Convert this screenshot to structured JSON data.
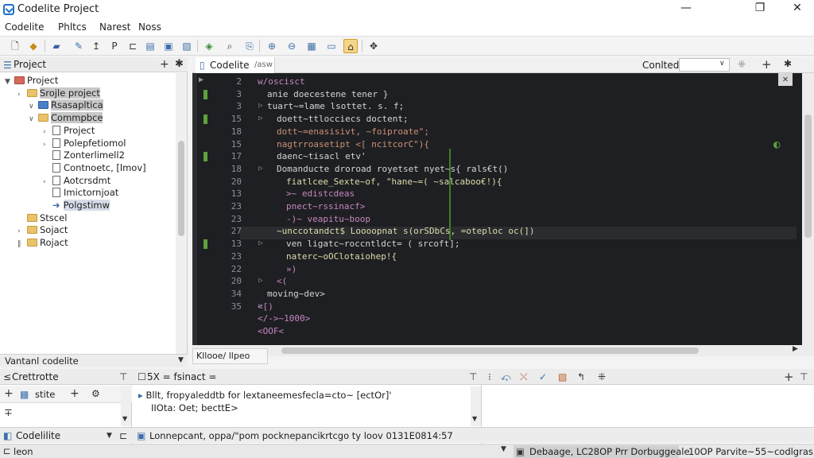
{
  "window": {
    "title": "Codelite Project",
    "minimize": "—",
    "maximize": "❐",
    "close": "✕"
  },
  "menu": [
    "Codelite",
    "Phltcs",
    "Narest",
    "Noss"
  ],
  "project_panel": {
    "title": "Project",
    "tree": [
      {
        "label": "Project",
        "depth": 0,
        "arrow": "▼",
        "kind": "proj",
        "selected": false
      },
      {
        "label": "Srojle project",
        "depth": 1,
        "arrow": "›",
        "kind": "folder",
        "selected": "gray"
      },
      {
        "label": "Rsasapltica",
        "depth": 2,
        "arrow": "∨",
        "kind": "folder-blue",
        "selected": "gray"
      },
      {
        "label": "Commpbce",
        "depth": 2,
        "arrow": "∨",
        "kind": "folder",
        "selected": "gray"
      },
      {
        "label": "Project",
        "depth": 3,
        "arrow": "›",
        "kind": "file",
        "selected": false
      },
      {
        "label": "Polepfetiomol",
        "depth": 3,
        "arrow": "›",
        "kind": "file",
        "selected": false
      },
      {
        "label": "Zonterlimell2",
        "depth": 3,
        "arrow": "",
        "kind": "file",
        "selected": false
      },
      {
        "label": "Contnoetc, [lmov]",
        "depth": 3,
        "arrow": "",
        "kind": "file",
        "selected": false
      },
      {
        "label": "Aotcrsdmt",
        "depth": 3,
        "arrow": "›",
        "kind": "file",
        "selected": false
      },
      {
        "label": "Imictornjoat",
        "depth": 3,
        "arrow": "",
        "kind": "file",
        "selected": false
      },
      {
        "label": "Polgstimw",
        "depth": 3,
        "arrow": "",
        "kind": "arrow-file",
        "selected": "blue"
      },
      {
        "label": "Stscel",
        "depth": 1,
        "arrow": "",
        "kind": "folder",
        "selected": false
      },
      {
        "label": "Sojact",
        "depth": 1,
        "arrow": "›",
        "kind": "folder",
        "selected": false
      },
      {
        "label": "Rojact",
        "depth": 1,
        "arrow": "‖",
        "kind": "folder",
        "selected": false
      }
    ],
    "footer": "Vantanl codelite"
  },
  "editor": {
    "tab_label": "Codelite",
    "tab_sub": "/asw",
    "right_label": "Conlted",
    "bottom_tab": "Kllooe/ llpeo",
    "lines": [
      {
        "num": "2",
        "code": "w/oscisct",
        "indent": 0,
        "color": "#c586c0",
        "marker": false,
        "fold": ""
      },
      {
        "num": "3",
        "code": "anie doecestene tener }",
        "indent": 1,
        "color": "#d4d4d4",
        "marker": true,
        "fold": ""
      },
      {
        "num": "3",
        "code": "tuart~=lame lsottet. s. f;",
        "indent": 1,
        "color": "#d4d4d4",
        "marker": false,
        "fold": "▷"
      },
      {
        "num": "15",
        "code": "doett~ttlocciecs doctent;",
        "indent": 2,
        "color": "#d4d4d4",
        "marker": true,
        "fold": "▷"
      },
      {
        "num": "18",
        "code": "dott~=enasisivt, ~foiproate\";",
        "indent": 2,
        "color": "#ce9178",
        "marker": false,
        "fold": ""
      },
      {
        "num": "15",
        "code": "nagtrroasetipt <[ ncitcorC\"){",
        "indent": 2,
        "color": "#ce9178",
        "marker": false,
        "fold": ""
      },
      {
        "num": "17",
        "code": "daenc~tisacl etv'",
        "indent": 2,
        "color": "#d4d4d4",
        "marker": true,
        "fold": ""
      },
      {
        "num": "18",
        "code": "Domanducte droroad royetset nyet~s{ rals€t()",
        "indent": 2,
        "color": "#d4d4d4",
        "marker": false,
        "fold": "▷"
      },
      {
        "num": "20",
        "code": "fiatlcee_Sexte~of, \"hane~=( ~salcaboo€!){",
        "indent": 3,
        "color": "#dcdcaa",
        "marker": false,
        "fold": ""
      },
      {
        "num": "13",
        "code": ">~ edistcdeas",
        "indent": 3,
        "color": "#c586c0",
        "marker": false,
        "fold": ""
      },
      {
        "num": "23",
        "code": "pnect~rssinacf>",
        "indent": 3,
        "color": "#c586c0",
        "marker": false,
        "fold": ""
      },
      {
        "num": "23",
        "code": "-)~ veapitu~boop",
        "indent": 3,
        "color": "#c586c0",
        "marker": false,
        "fold": ""
      },
      {
        "num": "27",
        "code": "~unccotandct$ Loooopnat s(orSDbCs, =oteploc oc(])",
        "indent": 2,
        "color": "#dcdcaa",
        "marker": false,
        "fold": ""
      },
      {
        "num": "13",
        "code": "ven ligatc~roccntldct= ( srcoft];",
        "indent": 3,
        "color": "#d4d4d4",
        "marker": true,
        "fold": "▷"
      },
      {
        "num": "23",
        "code": "naterc~oOClotaiohep!{",
        "indent": 3,
        "color": "#dcdcaa",
        "marker": false,
        "fold": ""
      },
      {
        "num": "22",
        "code": "»)",
        "indent": 3,
        "color": "#c586c0",
        "marker": false,
        "fold": ""
      },
      {
        "num": "20",
        "code": "<(",
        "indent": 2,
        "color": "#c586c0",
        "marker": false,
        "fold": "▷"
      },
      {
        "num": "34",
        "code": "moving~dev>",
        "indent": 1,
        "color": "#d4d4d4",
        "marker": false,
        "fold": ""
      },
      {
        "num": "35",
        "code": "<[)",
        "indent": 0,
        "color": "#c586c0",
        "marker": false,
        "fold": "▷"
      },
      {
        "num": "",
        "code": "</->~1000>",
        "indent": 0,
        "color": "#c586c0",
        "marker": false,
        "fold": ""
      },
      {
        "num": "",
        "code": "<OOF<",
        "indent": 0,
        "color": "#c586c0",
        "marker": false,
        "fold": ""
      }
    ]
  },
  "bottom_left": {
    "title": "Crettrotte",
    "tab": "stite",
    "footer": "Codelilite"
  },
  "bottom_mid": {
    "header": "5X = fsinact  =",
    "lines": [
      "Bllt, fropyaleddtb for lextaneemesfecla=cto~ [ectOr]'",
      "IIOta: Oet; becttE>"
    ],
    "footer": "Lonnepcant, oppa/\"pom   pocknepancikrtcgo  ty  loov  0131E0814:57"
  },
  "statusbar": {
    "left": "leon",
    "mid": "Debaage, LC28OP Prr Dorbuggeale",
    "right": "10OP Parvite~55~codlgras"
  },
  "colors": {
    "editor_bg": "#1e1f22",
    "accent": "#1e72c8",
    "git_marker": "#5fa13b"
  }
}
